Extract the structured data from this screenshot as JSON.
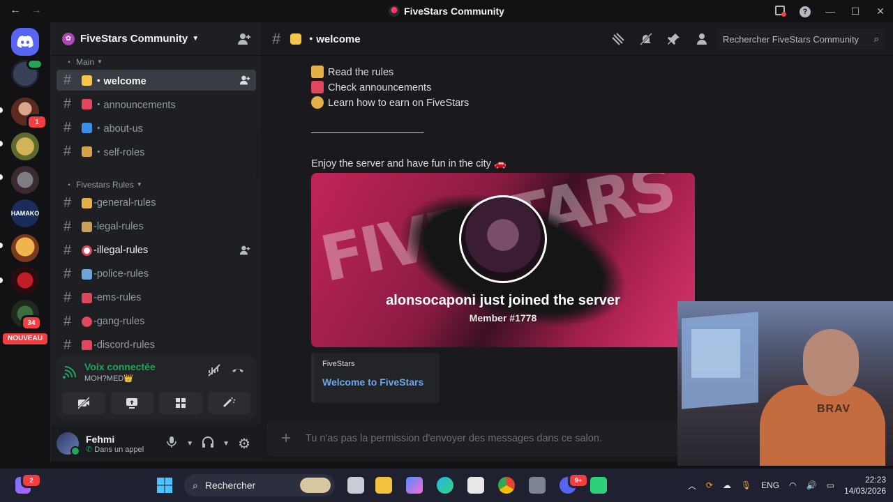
{
  "window": {
    "title": "FiveStars Community"
  },
  "rail": {
    "badges": {
      "server2": "1",
      "server8": "34"
    },
    "new_label": "NOUVEAU"
  },
  "server": {
    "name": "FiveStars Community"
  },
  "categories": [
    {
      "label": "Main"
    },
    {
      "label": "Fivestars Rules"
    }
  ],
  "channels": [
    {
      "name": "・welcome",
      "emoji_color": "#f5c64a",
      "active": true
    },
    {
      "name": "・announcements",
      "emoji_color": "#e0465c"
    },
    {
      "name": "・about-us",
      "emoji_color": "#3b8ee8"
    },
    {
      "name": "・self-roles",
      "emoji_color": "#d5a24b"
    },
    {
      "name": "-general-rules",
      "emoji_color": "#e3b04a"
    },
    {
      "name": "-legal-rules",
      "emoji_color": "#c9a15a"
    },
    {
      "name": "-illegal-rules",
      "emoji_color": "#e0465c"
    },
    {
      "name": "-police-rules",
      "emoji_color": "#6da5d8"
    },
    {
      "name": "-ems-rules",
      "emoji_color": "#d84a5a"
    },
    {
      "name": "-gang-rules",
      "emoji_color": "#e0465c"
    },
    {
      "name": "-discord-rules",
      "emoji_color": "#e0465c"
    }
  ],
  "voice": {
    "title": "Voix connectée",
    "subtitle": "MOH?MED👑"
  },
  "user": {
    "name": "Fehmi",
    "status": "Dans un appel"
  },
  "channel_header": {
    "name": "・welcome",
    "search_placeholder": "Rechercher FiveStars Community"
  },
  "messages": {
    "line1": "Read the rules",
    "line2": "Check announcements",
    "line3": "Learn how to earn on FiveStars",
    "divider": "____________________",
    "enjoy": "Enjoy the server and have fun in the city 🚗"
  },
  "embed": {
    "image_bg_text": "FIVESTARS",
    "joined_text": "alonsocaponi just joined the server",
    "member_text": "Member #1778",
    "provider": "FiveStars",
    "title": "Welcome to FiveStars"
  },
  "composer": {
    "placeholder": "Tu n'as pas la permission d'envoyer des messages dans ce salon."
  },
  "webcam": {
    "shirt_text": "BRAV"
  },
  "taskbar": {
    "search_label": "Rechercher",
    "badge": "2",
    "discord_badge": "9+",
    "lang": "ENG",
    "time": "22:23",
    "date": "14/03/2026"
  }
}
